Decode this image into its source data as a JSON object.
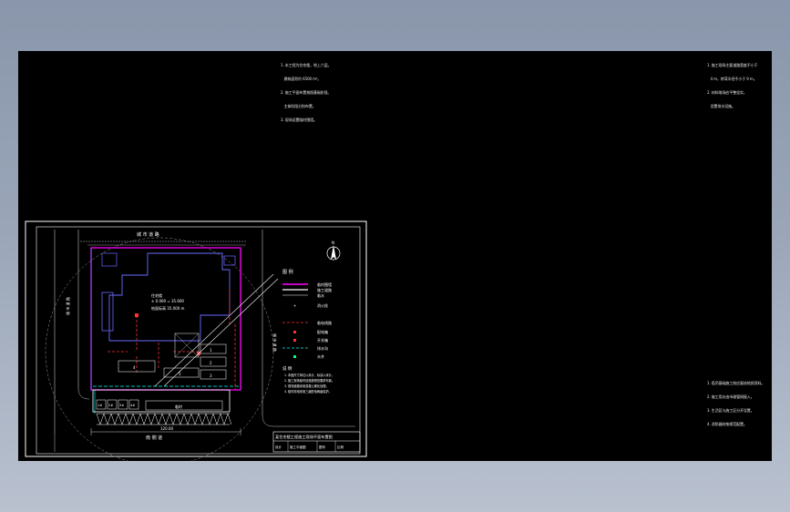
{
  "window": {
    "background_color": "#8f9bb0",
    "viewport_color": "#000000"
  },
  "drawing": {
    "compass_label": "N",
    "top_road_label": "城 市 道 路",
    "bottom_road_label": "南 侧 道",
    "left_road_label": "城 市 道 路",
    "right_road_label": "城 市 道 路",
    "building_label_1": "住宅楼",
    "building_label_2": "± 0.000 = 35.600",
    "building_label_3": "地面标高 35.000 m",
    "bottom_dim_label": "120.00",
    "row_labels": [
      "1#",
      "2#",
      "3#",
      "4#"
    ],
    "shed_label": "临时",
    "stair_labels": [
      "1",
      "2",
      "3",
      "4",
      "5"
    ]
  },
  "legend": {
    "title": "图 例",
    "items": [
      {
        "label": "临时围墙",
        "color": "#ff00ff"
      },
      {
        "label": "施工道路",
        "color": "#ffffff"
      },
      {
        "label": "临水",
        "color": "#ffffff"
      },
      {
        "label": "消火栓",
        "color": "#ffffff"
      },
      {
        "label": "临电线路",
        "color": "#ff3030"
      },
      {
        "label": "配电箱",
        "color": "#ff3030"
      },
      {
        "label": "开关箱",
        "color": "#ff3030"
      },
      {
        "label": "排水沟",
        "color": "#00ffff"
      },
      {
        "label": "水井",
        "color": "#00ff88"
      }
    ],
    "notes_title": "说 明",
    "notes": [
      "1. 本图尺寸单位以米计，标高以米计。",
      "2. 施工现场临时设施按规范要求布置。",
      "3. 现场道路采用混凝土硬化处理。",
      "4. 临时用电采用三级配电两级保护。"
    ]
  },
  "title_block": {
    "project": "某住宅楼工程施工现场平面布置图",
    "row2": [
      "设计",
      "施工平面图",
      "图号",
      "比例"
    ]
  },
  "notes_top_left": [
    "1. 本工程为住宅楼，地上六层，",
    "   建筑面积约 6500 m²。",
    "2. 施工平面布置按照基础阶段、",
    "   主体阶段分别布置。",
    "3. 现场设置临时围墙。"
  ],
  "notes_top_right": [
    "1. 施工现场主要道路宽度不小于",
    "   4 m，转弯半径不小于 9 m。",
    "2. 材料堆场应平整坚实，",
    "   设置排水设施。"
  ],
  "notes_bottom_right": [
    "1. 塔吊基础施工前应复核地质资料。",
    "2. 施工用水由市政管网接入。",
    "3. 生活区与施工区分开设置。",
    "4. 消防器材按规范配置。"
  ]
}
